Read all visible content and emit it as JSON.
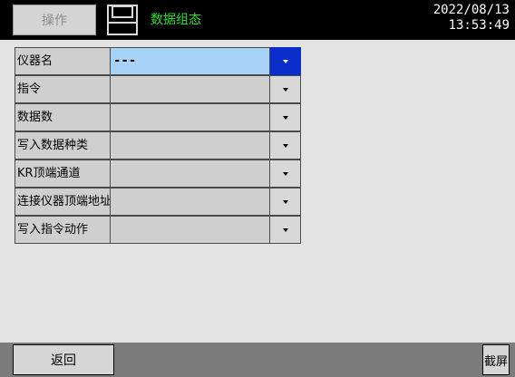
{
  "header": {
    "operate_label": "操作",
    "title": "数据组态",
    "date": "2022/08/13",
    "time": "13:53:49"
  },
  "params": [
    {
      "label": "仪器名",
      "value": "---",
      "selected": true
    },
    {
      "label": "指令",
      "value": "",
      "selected": false
    },
    {
      "label": "数据数",
      "value": "",
      "selected": false
    },
    {
      "label": "写入数据种类",
      "value": "",
      "selected": false
    },
    {
      "label": "KR顶端通道",
      "value": "",
      "selected": false
    },
    {
      "label": "连接仪器顶端地址",
      "value": "",
      "selected": false
    },
    {
      "label": "写入指令动作",
      "value": "",
      "selected": false
    }
  ],
  "footer": {
    "back_label": "返回",
    "screenshot_label": "截屏"
  },
  "colors": {
    "title_text": "#2ee02e",
    "selected_value_bg": "#a7d2f7",
    "selected_dropdown_bg": "#0a2dcc"
  }
}
